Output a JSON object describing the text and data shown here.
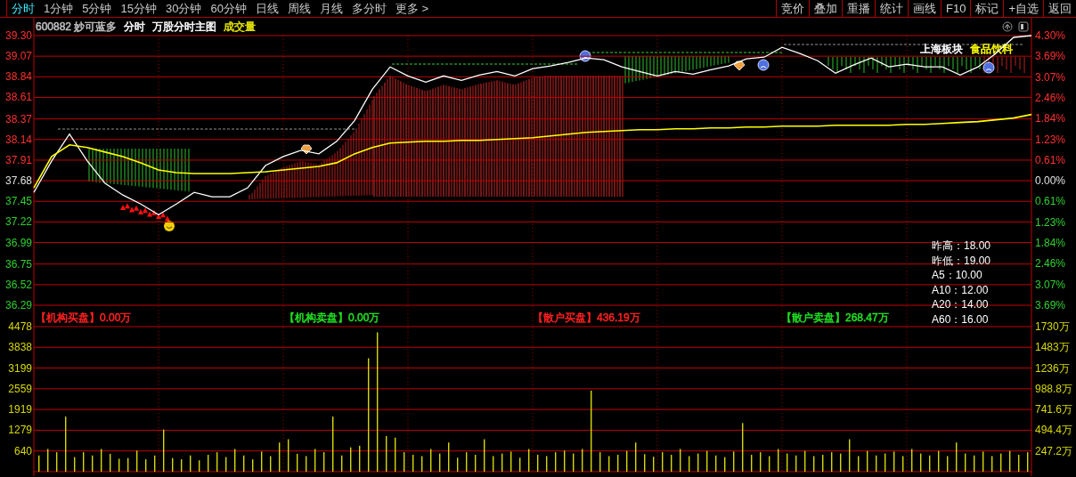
{
  "tabs": [
    {
      "label": "分时",
      "selected": true
    },
    {
      "label": "1分钟",
      "selected": false
    },
    {
      "label": "5分钟",
      "selected": false
    },
    {
      "label": "15分钟",
      "selected": false
    },
    {
      "label": "30分钟",
      "selected": false
    },
    {
      "label": "60分钟",
      "selected": false
    },
    {
      "label": "日线",
      "selected": false
    },
    {
      "label": "周线",
      "selected": false
    },
    {
      "label": "月线",
      "selected": false
    },
    {
      "label": "多分时",
      "selected": false
    },
    {
      "label": "更多 >",
      "selected": false
    }
  ],
  "toolbar": [
    "竞价",
    "叠加",
    "重播",
    "统计",
    "画线",
    "F10",
    "标记",
    "+自选",
    "返回"
  ],
  "header": [
    {
      "text": "600882 妙可蓝多",
      "color": "#c0c0c0"
    },
    {
      "text": "分时",
      "color": "#ffffff"
    },
    {
      "text": "万股分时主图",
      "color": "#ffffff"
    },
    {
      "text": "成交量",
      "color": "#e0e000"
    }
  ],
  "price_chart": {
    "chart_data": {
      "type": "line",
      "ylim": [
        36.29,
        39.3
      ],
      "grid": true,
      "yticks": [
        {
          "value": 39.3,
          "label": "39.30"
        },
        {
          "value": 39.07,
          "label": "39.07"
        },
        {
          "value": 38.84,
          "label": "38.84"
        },
        {
          "value": 38.61,
          "label": "38.61"
        },
        {
          "value": 38.37,
          "label": "38.37"
        },
        {
          "value": 38.14,
          "label": "38.14"
        },
        {
          "value": 37.91,
          "label": "37.91"
        },
        {
          "value": 37.68,
          "label": "37.68"
        },
        {
          "value": 37.45,
          "label": "37.45"
        },
        {
          "value": 37.22,
          "label": "37.22"
        },
        {
          "value": 36.99,
          "label": "36.99"
        },
        {
          "value": 36.75,
          "label": "36.75"
        },
        {
          "value": 36.52,
          "label": "36.52"
        },
        {
          "value": 36.29,
          "label": "36.29"
        }
      ],
      "series": [
        {
          "color": "#ffffff",
          "values": [
            37.55,
            37.9,
            38.2,
            37.9,
            37.65,
            37.52,
            37.42,
            37.3,
            37.42,
            37.55,
            37.5,
            37.5,
            37.6,
            37.85,
            37.95,
            38.02,
            37.98,
            38.12,
            38.35,
            38.7,
            38.95,
            38.85,
            38.78,
            38.85,
            38.8,
            38.86,
            38.9,
            38.85,
            38.93,
            38.96,
            39.0,
            39.05,
            39.03,
            38.95,
            38.9,
            38.85,
            38.9,
            38.87,
            38.92,
            38.96,
            39.04,
            39.06,
            39.17,
            39.1,
            39.02,
            38.88,
            38.97,
            39.05,
            38.95,
            38.98,
            38.95,
            38.95,
            38.86,
            38.95,
            39.1,
            39.28,
            39.3
          ]
        },
        {
          "color": "#ffff00",
          "values": [
            37.6,
            37.95,
            38.08,
            38.05,
            38.0,
            37.95,
            37.88,
            37.8,
            37.77,
            37.76,
            37.76,
            37.76,
            37.77,
            37.78,
            37.8,
            37.82,
            37.84,
            37.88,
            37.98,
            38.05,
            38.1,
            38.11,
            38.12,
            38.12,
            38.13,
            38.13,
            38.14,
            38.15,
            38.16,
            38.18,
            38.2,
            38.22,
            38.23,
            38.24,
            38.25,
            38.25,
            38.26,
            38.26,
            38.27,
            38.27,
            38.28,
            38.28,
            38.29,
            38.29,
            38.29,
            38.3,
            38.3,
            38.3,
            38.3,
            38.31,
            38.31,
            38.32,
            38.33,
            38.34,
            38.36,
            38.38,
            38.42
          ]
        }
      ]
    },
    "percent_axis": [
      {
        "label": "4.30%",
        "kind": "up"
      },
      {
        "label": "3.69%",
        "kind": "up"
      },
      {
        "label": "3.07%",
        "kind": "up"
      },
      {
        "label": "2.46%",
        "kind": "up"
      },
      {
        "label": "1.84%",
        "kind": "up"
      },
      {
        "label": "1.23%",
        "kind": "up"
      },
      {
        "label": "0.61%",
        "kind": "up"
      },
      {
        "label": "0.00%",
        "kind": "flat"
      },
      {
        "label": "0.61%",
        "kind": "down"
      },
      {
        "label": "1.23%",
        "kind": "down"
      },
      {
        "label": "1.84%",
        "kind": "down"
      },
      {
        "label": "2.46%",
        "kind": "down"
      },
      {
        "label": "3.07%",
        "kind": "down"
      },
      {
        "label": "3.69%",
        "kind": "down"
      }
    ],
    "sector_labels": [
      {
        "text": "上海板块",
        "color": "#ffffff"
      },
      {
        "text": "食品饮料",
        "color": "#ffff00"
      }
    ],
    "info": [
      "昨高：18.00",
      "昨低：19.00",
      "A5：10.00",
      "A10：12.00",
      "A20：14.00",
      "A60：16.00"
    ]
  },
  "legend": [
    {
      "text": "【机构买盘】0.00万",
      "color": "#ff2020"
    },
    {
      "text": "【机构卖盘】0.00万",
      "color": "#20e020"
    },
    {
      "text": "【散户买盘】436.19万",
      "color": "#ff2020"
    },
    {
      "text": "【散户卖盘】268.47万",
      "color": "#20e020"
    }
  ],
  "volume_chart": {
    "chart_data": {
      "type": "bar",
      "ylim": [
        0,
        4478
      ],
      "grid": true,
      "yticks": [
        {
          "value": 4478,
          "label": "4478"
        },
        {
          "value": 3838,
          "label": "3838"
        },
        {
          "value": 3199,
          "label": "3199"
        },
        {
          "value": 2559,
          "label": "2559"
        },
        {
          "value": 1919,
          "label": "1919"
        },
        {
          "value": 1279,
          "label": "1279"
        },
        {
          "value": 640,
          "label": "640"
        }
      ],
      "series": [
        {
          "color": "#d8d800",
          "values": [
            500,
            700,
            600,
            1700,
            450,
            600,
            500,
            700,
            550,
            400,
            420,
            650,
            380,
            500,
            1300,
            420,
            380,
            500,
            350,
            520,
            600,
            450,
            700,
            500,
            380,
            620,
            480,
            900,
            1000,
            550,
            480,
            700,
            600,
            1700,
            500,
            750,
            800,
            3500,
            4300,
            1100,
            1050,
            600,
            520,
            480,
            700,
            560,
            900,
            430,
            600,
            520,
            1000,
            480,
            560,
            620,
            430,
            700,
            520,
            480,
            600,
            650,
            560,
            700,
            2500,
            600,
            480,
            520,
            640,
            900,
            540,
            460,
            600,
            520,
            700,
            480,
            560,
            640,
            500,
            450,
            620,
            1500,
            520,
            600,
            480,
            700,
            560,
            500,
            640,
            480,
            520,
            600,
            560,
            1000,
            480,
            640,
            500,
            560,
            620,
            480,
            700,
            560,
            500,
            640,
            480,
            900,
            560,
            500,
            620,
            480,
            560,
            640,
            520,
            600
          ]
        }
      ]
    },
    "amount_axis": [
      "1730万",
      "1483万",
      "1236万",
      "988.8万",
      "741.6万",
      "494.4万",
      "247.2万"
    ]
  }
}
